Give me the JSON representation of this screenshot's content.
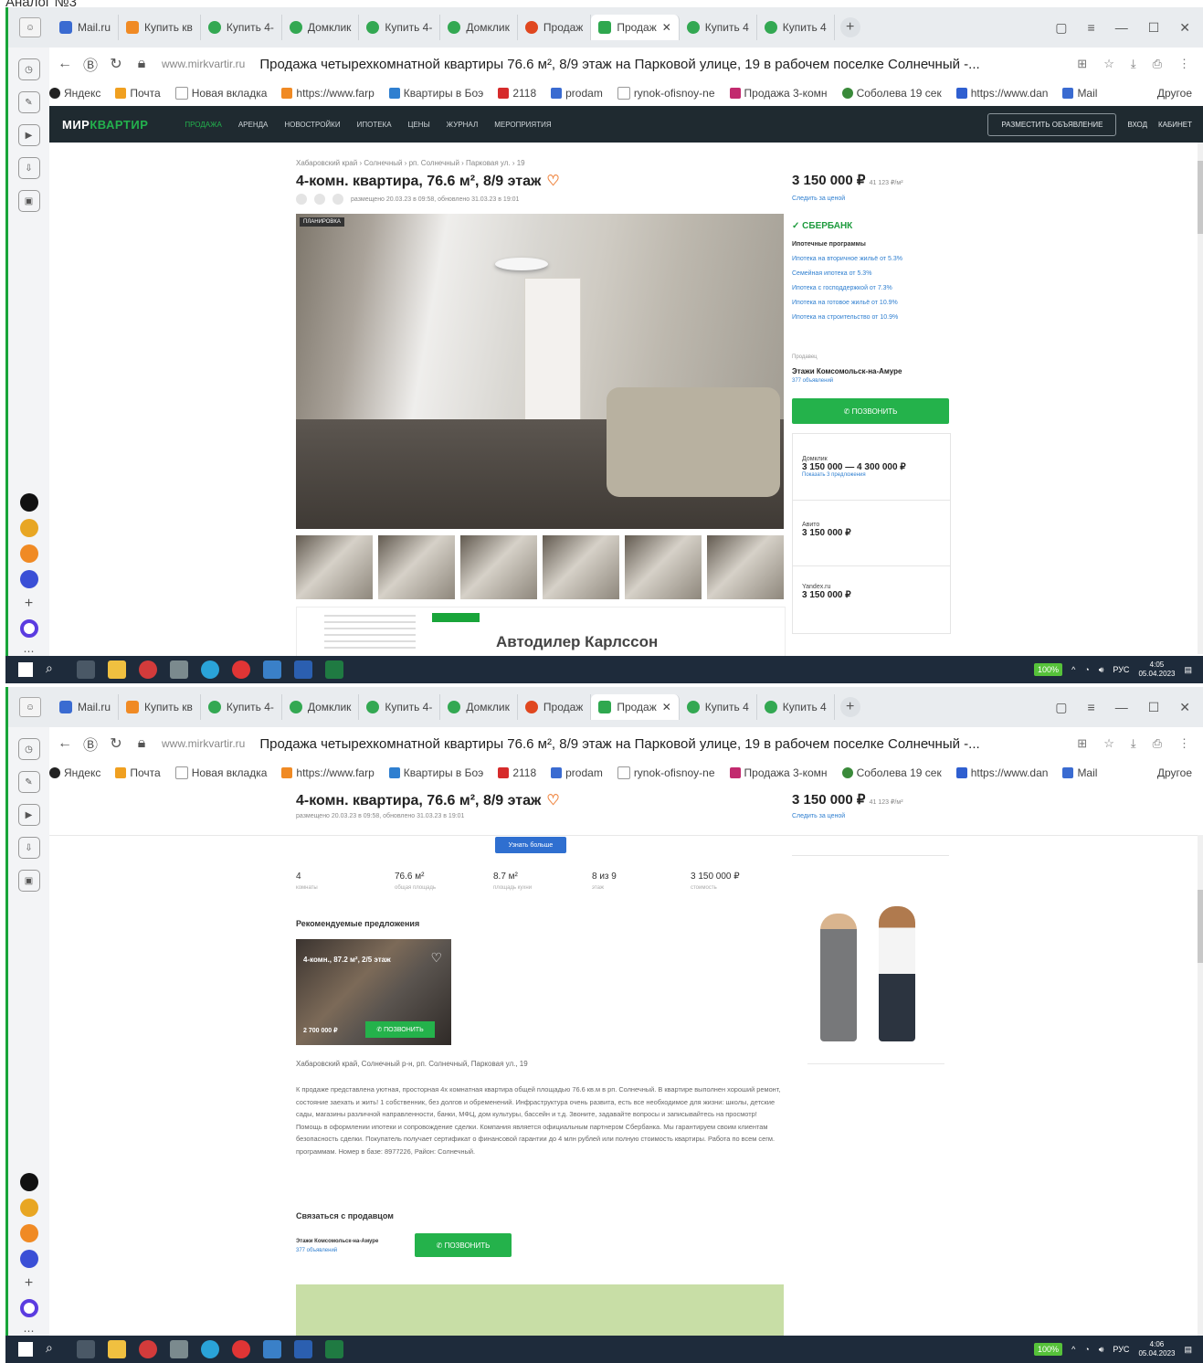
{
  "doc_title": "Аналог №3",
  "browser": {
    "tabs": [
      {
        "label": "Mail.ru",
        "color": "#3a6bd1"
      },
      {
        "label": "Купить кв",
        "color": "#f08a24"
      },
      {
        "label": "Купить 4-",
        "color": "#33a852"
      },
      {
        "label": "Домклик",
        "color": "#33a852"
      },
      {
        "label": "Купить 4-",
        "color": "#33a852"
      },
      {
        "label": "Домклик",
        "color": "#33a852"
      },
      {
        "label": "Продаж",
        "color": "#e0471f"
      },
      {
        "label": "Продаж",
        "color": "#2fa84f",
        "active": true
      },
      {
        "label": "Купить 4",
        "color": "#33a852"
      },
      {
        "label": "Купить 4",
        "color": "#33a852"
      }
    ],
    "url": "www.mirkvartir.ru",
    "page_title": "Продажа четырехкомнатной квартиры 76.6 м², 8/9 этаж на Парковой улице, 19 в рабочем поселке Солнечный -...",
    "bookmarks": [
      {
        "label": "Яндекс",
        "color": "#222"
      },
      {
        "label": "Почта",
        "color": "#f0a020"
      },
      {
        "label": "Новая вкладка",
        "color": "#bbb"
      },
      {
        "label": "https://www.farp",
        "color": "#f08a24"
      },
      {
        "label": "Квартиры в Боэ",
        "color": "#2f7fd0"
      },
      {
        "label": "2118",
        "color": "#d62b2b"
      },
      {
        "label": "prodam",
        "color": "#3a6bd1"
      },
      {
        "label": "rynok-ofisnoy-ne",
        "color": "#bbb"
      },
      {
        "label": "Продажа 3-комн",
        "color": "#c22a6e"
      },
      {
        "label": "Соболева 19 сек",
        "color": "#3a8a3a"
      },
      {
        "label": "https://www.dan",
        "color": "#2f5fd0"
      },
      {
        "label": "Mail",
        "color": "#3a6bd1"
      },
      {
        "label": "Другое",
        "color": "#bbb"
      }
    ],
    "window_controls": [
      "▢",
      "≡",
      "—",
      "☐",
      "✕"
    ],
    "address_tools": [
      "⊞",
      "☆",
      "⤓",
      "⎙",
      "⋮"
    ]
  },
  "site": {
    "logo_a": "МИР",
    "logo_b": "КВАРТИР",
    "nav": [
      "Продажа",
      "Аренда",
      "Новостройки",
      "Ипотека",
      "Цены",
      "Журнал",
      "Мероприятия"
    ],
    "post_button": "РАЗМЕСТИТЬ ОБЪЯВЛЕНИЕ",
    "login": "ВХОД",
    "register": "КАБИНЕТ"
  },
  "listing": {
    "breadcrumb": "Хабаровский край › Солнечный › рп. Солнечный › Парковая ул. › 19",
    "title": "4-комн. квартира, 76.6 м², 8/9 этаж",
    "meta": "размещено 20.03.23 в 09:58, обновлено 31.03.23 в 19:01",
    "photo_tag": "ПЛАНИРОВКА",
    "price": "3 150 000 ₽",
    "price_note": "41 123 ₽/м²",
    "price_link": "Следить за ценой",
    "ad_title": "Автодилер Карлссон"
  },
  "side": {
    "bank": "СБЕРБАНК",
    "mortgage_heading": "Ипотечные программы",
    "mortgage_items": [
      "Ипотека на вторичное жильё от 5.3%",
      "Семейная ипотека от 5.3%",
      "Ипотека с господдержкой от 7.3%",
      "Ипотека на готовое жильё от 10.9%",
      "Ипотека на строительство от 10.9%"
    ],
    "seller_caption": "Продавец",
    "seller_name": "Этажи Комсомольск-на-Амуре",
    "seller_sub": "377 объявлений",
    "call_button": "ПОЗВОНИТЬ",
    "price_cards": [
      {
        "source": "Домклик",
        "value": "3 150 000 — 4 300 000 ₽",
        "link": "Показать 3 предложения"
      },
      {
        "source": "Авито",
        "value": "3 150 000 ₽",
        "link": ""
      },
      {
        "source": "Yandex.ru",
        "value": "3 150 000 ₽",
        "link": ""
      }
    ]
  },
  "taskbar": {
    "battery": "100%",
    "lang": "РУС",
    "time1": "4:05",
    "date1": "05.04.2023",
    "time2": "4:06",
    "date2": "05.04.2023"
  },
  "screen2": {
    "show_more": "Узнать больше",
    "stats": [
      {
        "value": "4",
        "label": "комнаты"
      },
      {
        "value": "76.6 м²",
        "label": "общая площадь"
      },
      {
        "value": "8.7 м²",
        "label": "площадь кухни"
      },
      {
        "value": "8 из 9",
        "label": "этаж"
      },
      {
        "value": "3 150 000 ₽",
        "label": "стоимость"
      }
    ],
    "rec_heading": "Рекомендуемые предложения",
    "rec_title": "4-комн., 87.2 м², 2/5 этаж",
    "rec_price": "2 700 000 ₽",
    "rec_call": "ПОЗВОНИТЬ",
    "address": "Хабаровский край, Солнечный р-н, рп. Солнечный, Парковая ул., 19",
    "description": "К продаже представлена уютная, просторная 4х комнатная квартира общей площадью 76.6 кв.м в рп. Солнечный. В квартире выполнен хороший ремонт, состояние заехать и жить! 1 собственник, без долгов и обременений. Инфраструктура очень развита, есть все необходимое для жизни: школы, детские сады, магазины различной направленности, банки, МФЦ, дом культуры, бассейн и т.д. Звоните, задавайте вопросы и записывайтесь на просмотр! Помощь в оформлении ипотеки и сопровождение сделки. Компания является официальным партнером Сбербанка. Мы гарантируем своим клиентам безопасность сделки. Покупатель получает сертификат о финансовой гарантии до 4 млн рублей или полную стоимость квартиры. Работа по всем сегм. программам. Номер в базе: 8977226, Район: Солнечный.",
    "contact_heading": "Связаться с продавцом",
    "seller_name": "Этажи Комсомольск-на-Амуре",
    "seller_sub": "377 объявлений",
    "call_button": "ПОЗВОНИТЬ"
  }
}
